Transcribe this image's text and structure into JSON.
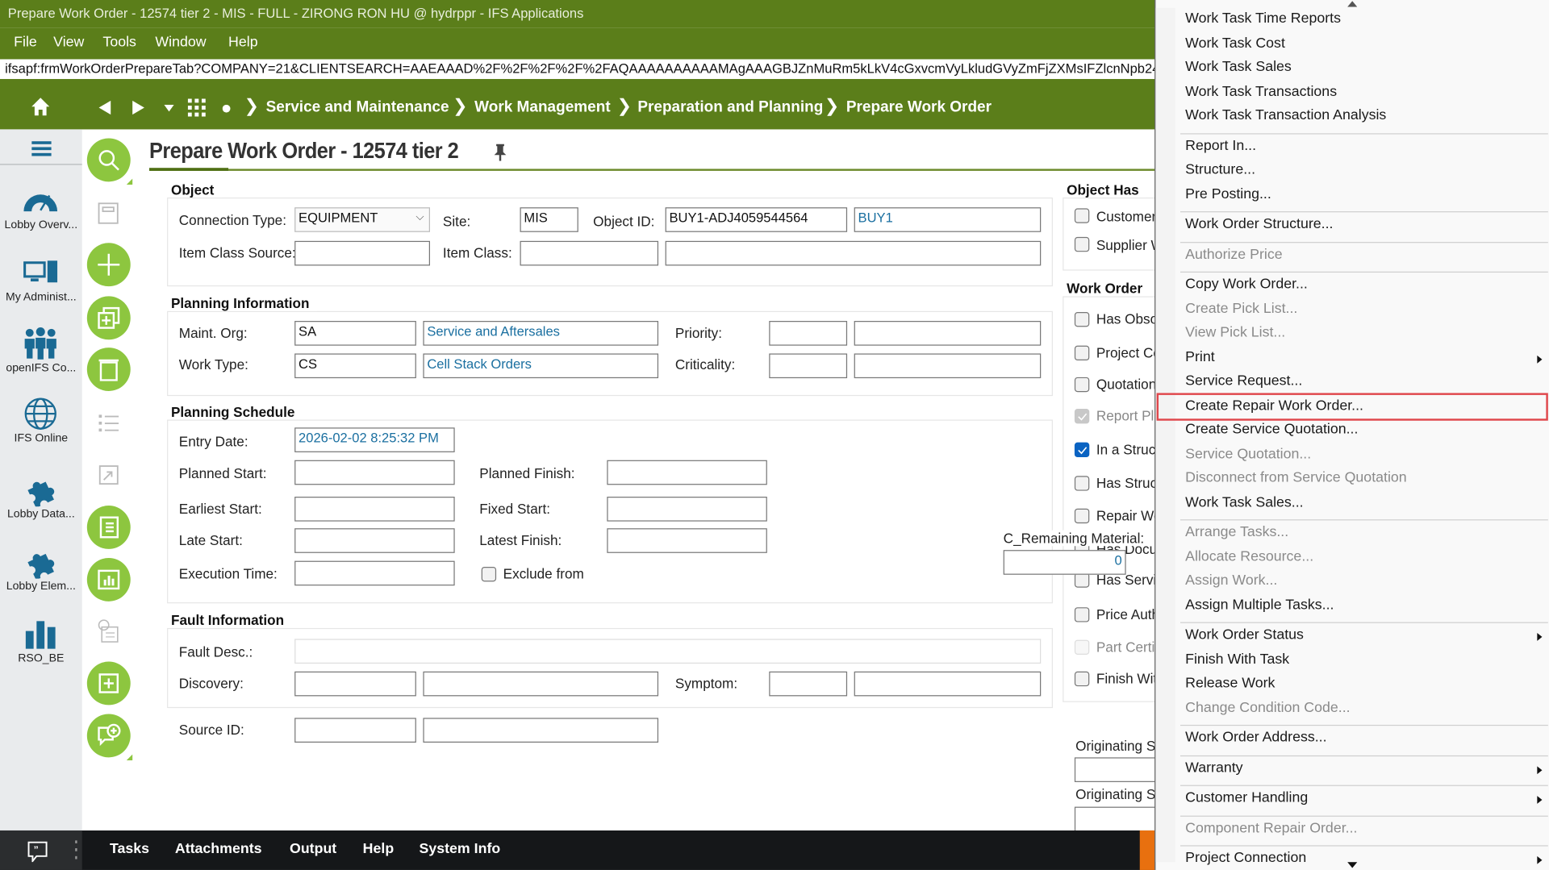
{
  "window": {
    "title": "Prepare Work Order - 12574 tier 2 - MIS - FULL - ZIRONG RON HU @ hydrppr - IFS Applications"
  },
  "menubar": [
    "File",
    "View",
    "Tools",
    "Window",
    "Help"
  ],
  "url": "ifsapf:frmWorkOrderPrepareTab?COMPANY=21&CLIENTSEARCH=AAEAAAD%2F%2F%2F%2F%2FAQAAAAAAAAAAMAgAAAGBJZnMuRm5kLkV4cGxvcmVyLkludGVyZmFjZXMsIFZlcnNpb249NC",
  "breadcrumb": [
    "Service and Maintenance",
    "Work Management",
    "Preparation and Planning",
    "Prepare Work Order"
  ],
  "sidebar": [
    {
      "label": "Lobby Overv...",
      "icon": "gauge-icon"
    },
    {
      "label": "My Administ...",
      "icon": "computer-icon"
    },
    {
      "label": "openIFS Co...",
      "icon": "people-icon"
    },
    {
      "label": "IFS Online",
      "icon": "globe-icon"
    },
    {
      "label": "Lobby Data...",
      "icon": "puzzle-icon"
    },
    {
      "label": "Lobby Elem...",
      "icon": "puzzle-icon"
    },
    {
      "label": "RSO_BE",
      "icon": "bar-chart-icon"
    }
  ],
  "page_title": "Prepare Work Order - 12574 tier 2",
  "object": {
    "header": "Object",
    "connection_type_label": "Connection Type:",
    "connection_type": "EQUIPMENT",
    "site_label": "Site:",
    "site": "MIS",
    "object_id_label": "Object ID:",
    "object_id": "BUY1-ADJ4059544564",
    "object_desc": "BUY1",
    "item_class_source_label": "Item Class Source:",
    "item_class_label": "Item Class:"
  },
  "planning_info": {
    "header": "Planning Information",
    "maint_org_label": "Maint. Org:",
    "maint_org": "SA",
    "maint_org_desc": "Service and Aftersales",
    "work_type_label": "Work Type:",
    "work_type": "CS",
    "work_type_desc": "Cell Stack Orders",
    "priority_label": "Priority:",
    "criticality_label": "Criticality:"
  },
  "schedule": {
    "header": "Planning Schedule",
    "entry_date_label": "Entry Date:",
    "entry_date": "2026-02-02 8:25:32 PM",
    "planned_start_label": "Planned Start:",
    "planned_finish_label": "Planned Finish:",
    "earliest_start_label": "Earliest Start:",
    "fixed_start_label": "Fixed Start:",
    "late_start_label": "Late Start:",
    "latest_finish_label": "Latest Finish:",
    "execution_time_label": "Execution Time:",
    "exclude_label": "Exclude from"
  },
  "fault": {
    "header": "Fault Information",
    "fault_desc_label": "Fault Desc.:",
    "discovery_label": "Discovery:",
    "symptom_label": "Symptom:",
    "source_id_label": "Source ID:"
  },
  "object_has": {
    "header": "Object Has",
    "items": [
      "Customer",
      "Supplier W"
    ]
  },
  "work_order": {
    "header": "Work Order",
    "items": [
      {
        "label": "Has Obso",
        "checked": false,
        "disabled": false
      },
      {
        "label": "Project Co",
        "checked": false,
        "disabled": false
      },
      {
        "label": "Quotation",
        "checked": false,
        "disabled": false
      },
      {
        "label": "Report Pl",
        "checked": true,
        "disabled": true
      },
      {
        "label": "In a Struc",
        "checked": true,
        "disabled": false
      },
      {
        "label": "Has Struc",
        "checked": false,
        "disabled": false
      },
      {
        "label": "Repair Wo",
        "checked": false,
        "disabled": false
      },
      {
        "label": "Has Docu",
        "checked": false,
        "disabled": false
      },
      {
        "label": "Has Servi",
        "checked": false,
        "disabled": false
      },
      {
        "label": "Price Auth",
        "checked": false,
        "disabled": false
      },
      {
        "label": "Part Certi",
        "checked": false,
        "disabled": true
      },
      {
        "label": "Finish Wit",
        "checked": false,
        "disabled": false
      }
    ]
  },
  "remaining_material": {
    "label": "C_Remaining Material:",
    "value": "0"
  },
  "originating": [
    "Originating S",
    "Originating S"
  ],
  "bottom_tabs": [
    "Tasks",
    "Attachments",
    "Output",
    "Help",
    "System Info"
  ],
  "context_menu": {
    "highlight_color": "#e0474c",
    "items": [
      {
        "label": "Work Task Time Reports"
      },
      {
        "label": "Work Task Cost"
      },
      {
        "label": "Work Task Sales"
      },
      {
        "label": "Work Task Transactions"
      },
      {
        "label": "Work Task Transaction Analysis"
      },
      {
        "sep": true
      },
      {
        "label": "Report In..."
      },
      {
        "label": "Structure..."
      },
      {
        "label": "Pre Posting..."
      },
      {
        "sep": true
      },
      {
        "label": "Work Order Structure..."
      },
      {
        "sep": true
      },
      {
        "label": "Authorize Price",
        "disabled": true
      },
      {
        "sep": true
      },
      {
        "label": "Copy Work Order..."
      },
      {
        "label": "Create Pick List...",
        "disabled": true
      },
      {
        "label": "View Pick List...",
        "disabled": true
      },
      {
        "label": "Print",
        "submenu": true
      },
      {
        "label": "Service Request..."
      },
      {
        "label": "Create Repair Work Order...",
        "highlighted": true
      },
      {
        "label": "Create Service Quotation..."
      },
      {
        "label": "Service Quotation...",
        "disabled": true
      },
      {
        "label": "Disconnect from Service Quotation",
        "disabled": true
      },
      {
        "label": "Work Task Sales..."
      },
      {
        "sep": true
      },
      {
        "label": "Arrange Tasks...",
        "disabled": true
      },
      {
        "label": "Allocate Resource...",
        "disabled": true
      },
      {
        "label": "Assign Work...",
        "disabled": true
      },
      {
        "label": "Assign Multiple Tasks..."
      },
      {
        "sep": true
      },
      {
        "label": "Work Order Status",
        "submenu": true
      },
      {
        "label": "Finish With Task"
      },
      {
        "label": "Release Work"
      },
      {
        "label": "Change Condition Code...",
        "disabled": true
      },
      {
        "sep": true
      },
      {
        "label": "Work Order Address..."
      },
      {
        "sep": true
      },
      {
        "label": "Warranty",
        "submenu": true
      },
      {
        "sep": true
      },
      {
        "label": "Customer Handling",
        "submenu": true
      },
      {
        "sep": true
      },
      {
        "label": "Component Repair Order...",
        "disabled": true
      },
      {
        "sep": true
      },
      {
        "label": "Project Connection",
        "submenu": true
      },
      {
        "sep": true
      }
    ]
  }
}
